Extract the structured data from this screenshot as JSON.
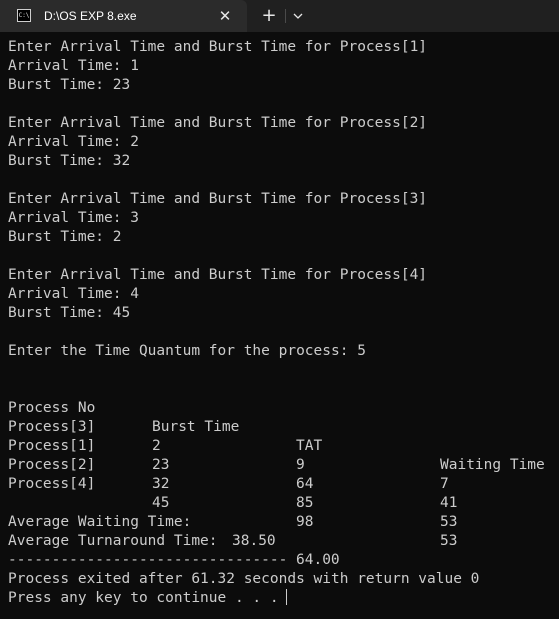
{
  "tab": {
    "icon_text": "C:\\",
    "title": "D:\\OS EXP 8.exe",
    "close_glyph": "✕",
    "new_tab_glyph": "+"
  },
  "console": {
    "inputs": [
      {
        "prompt": "Enter Arrival Time and Burst Time for Process[1]",
        "arrival": "Arrival Time: 1",
        "burst": "Burst Time: 23"
      },
      {
        "prompt": "Enter Arrival Time and Burst Time for Process[2]",
        "arrival": "Arrival Time: 2",
        "burst": "Burst Time: 32"
      },
      {
        "prompt": "Enter Arrival Time and Burst Time for Process[3]",
        "arrival": "Arrival Time: 3",
        "burst": "Burst Time: 2"
      },
      {
        "prompt": "Enter Arrival Time and Burst Time for Process[4]",
        "arrival": "Arrival Time: 4",
        "burst": "Burst Time: 45"
      }
    ],
    "quantum": "Enter the Time Quantum for the process: 5",
    "table": {
      "headers": [
        "Process No",
        "Burst Time",
        "TAT",
        "Waiting Time"
      ],
      "rows": [
        [
          "Process[3]",
          "2",
          "9",
          "7"
        ],
        [
          "Process[1]",
          "23",
          "64",
          "41"
        ],
        [
          "Process[2]",
          "32",
          "85",
          "53"
        ],
        [
          "Process[4]",
          "45",
          "98",
          "53"
        ]
      ]
    },
    "avg_waiting_label": "Average Waiting Time:",
    "avg_waiting_value": "38.50",
    "avg_tat_label": "Average Turnaround Time:",
    "avg_tat_value": "64.00",
    "separator": "--------------------------------",
    "exit_message": "Process exited after 61.32 seconds with return value 0",
    "continue_prompt": "Press any key to continue . . ."
  }
}
